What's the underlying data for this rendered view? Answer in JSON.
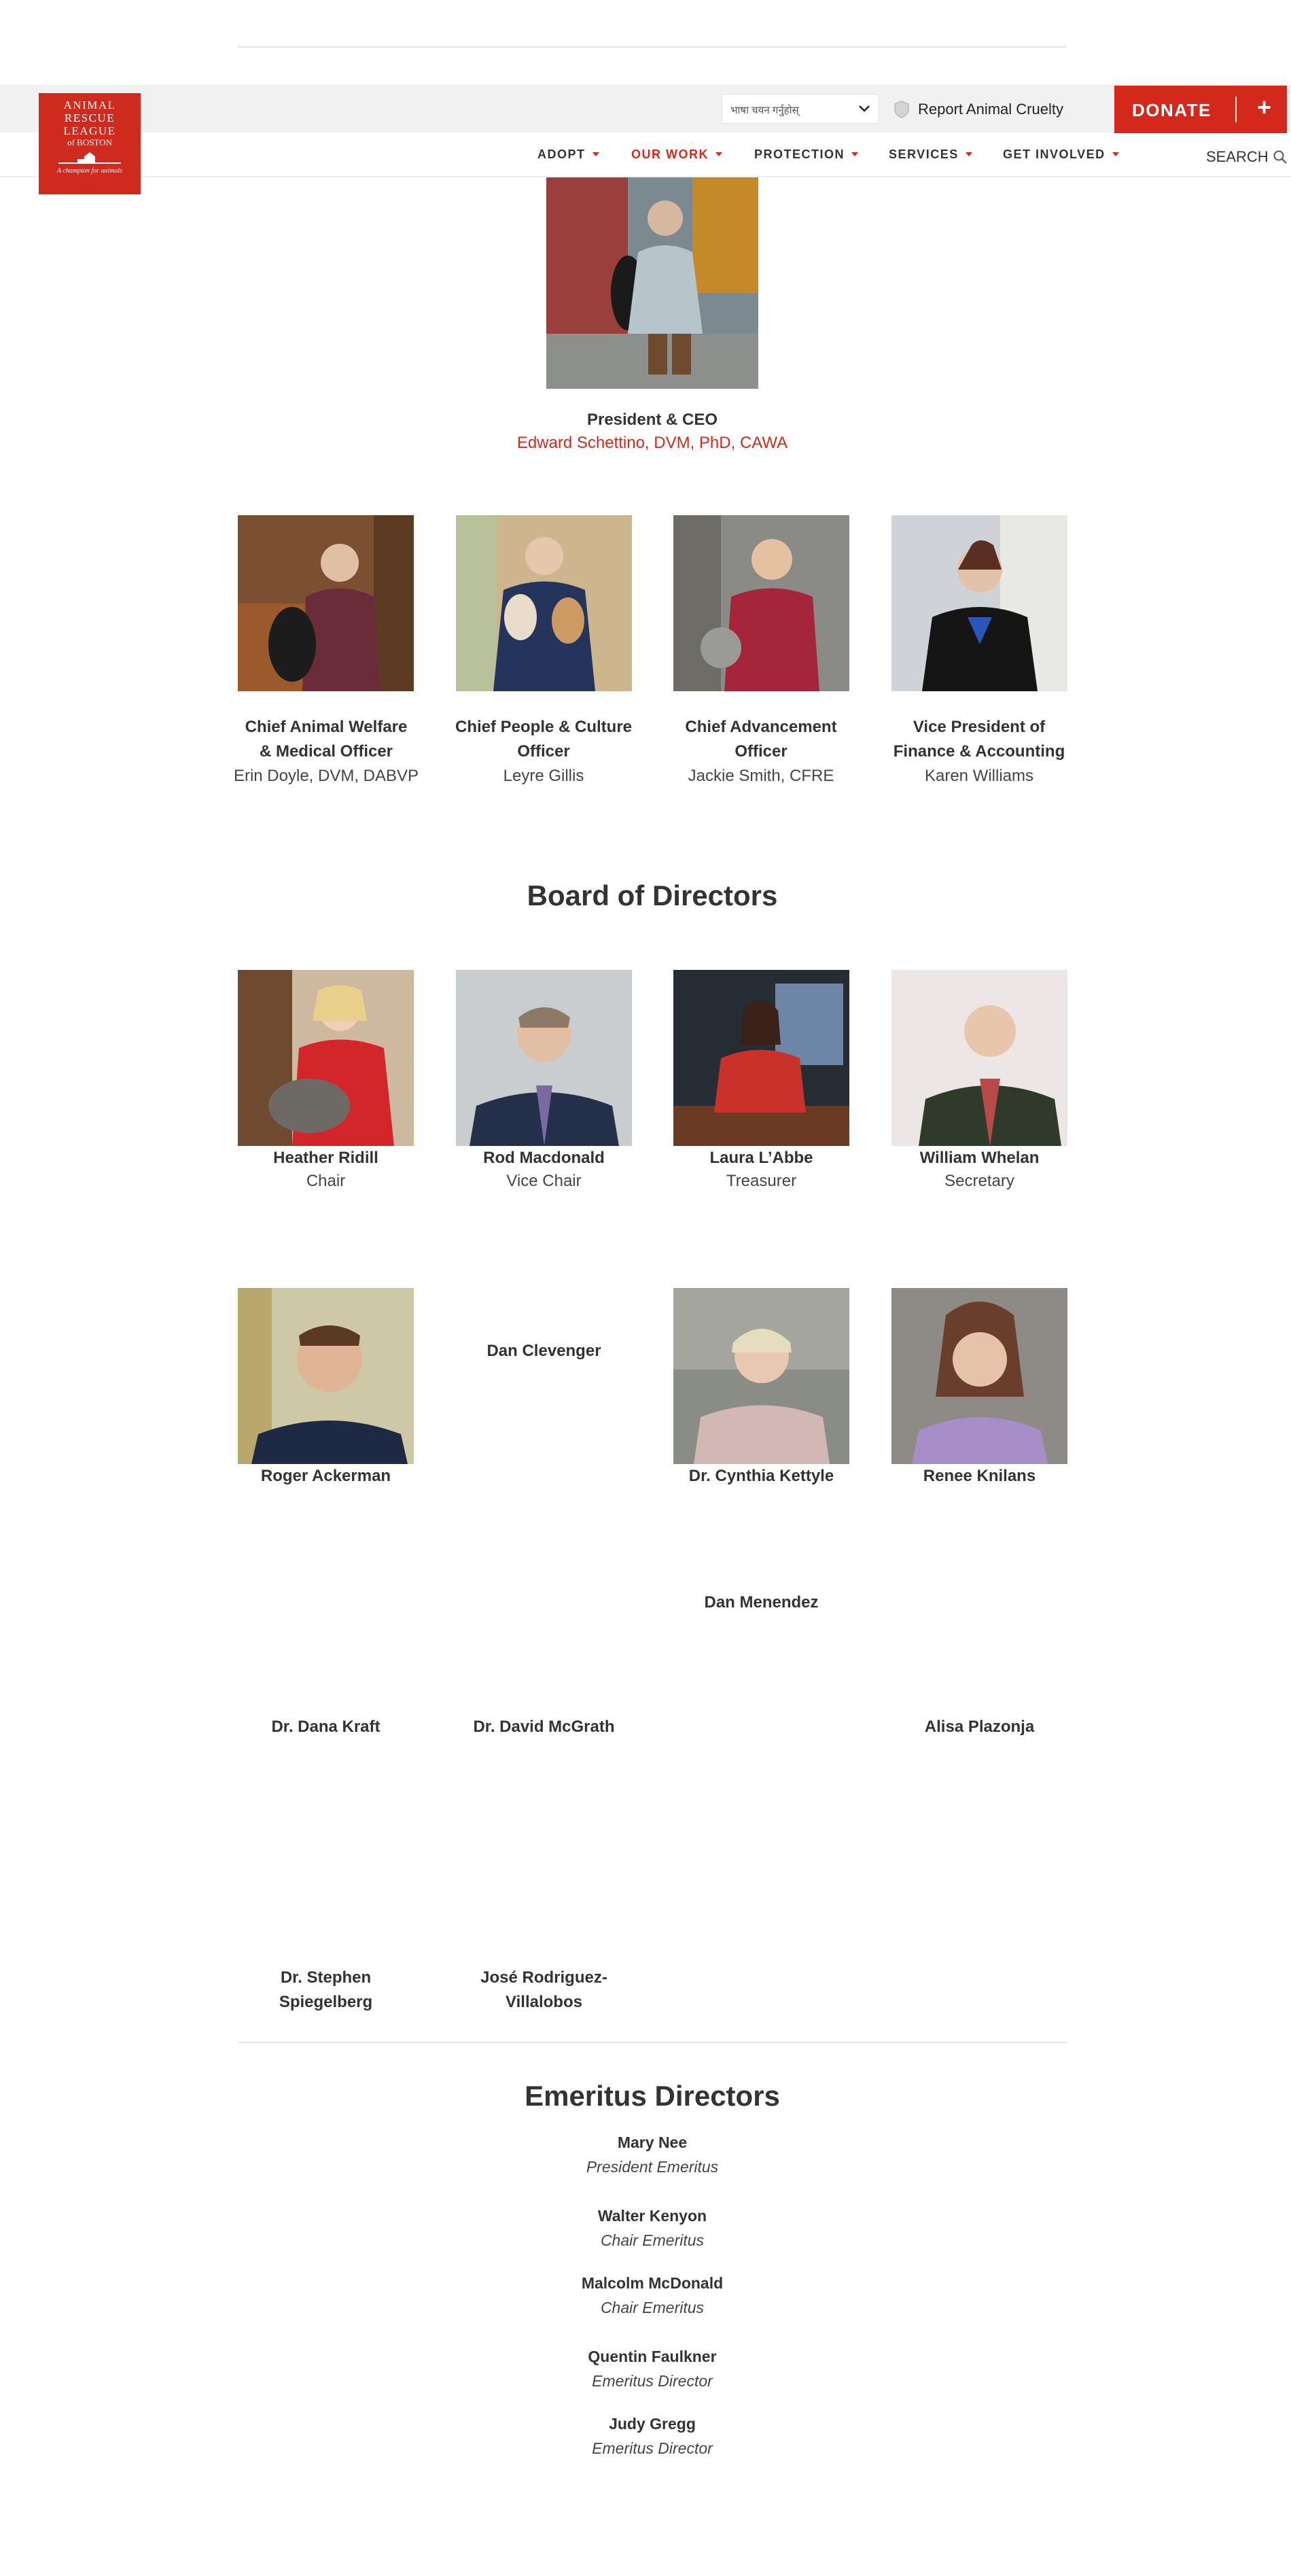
{
  "header": {
    "logo": {
      "line1": "ANIMAL",
      "line2": "RESCUE",
      "line3": "LEAGUE",
      "line4": "of BOSTON",
      "tagline": "A champion for animals"
    },
    "language_select": {
      "value": "भाषा चयन गर्नुहोस्"
    },
    "report_link": "Report Animal Cruelty",
    "donate_label": "DONATE",
    "donate_plus": "+",
    "nav": [
      {
        "label": "ADOPT"
      },
      {
        "label": "OUR WORK"
      },
      {
        "label": "PROTECTION"
      },
      {
        "label": "SERVICES"
      },
      {
        "label": "GET INVOLVED"
      }
    ],
    "search_label": "SEARCH",
    "brand_color": "#d5281c"
  },
  "ceo": {
    "title": "President & CEO",
    "name": "Edward Schettino, DVM, PhD, CAWA"
  },
  "executives": [
    {
      "title_line1": "Chief Animal Welfare",
      "title_line2": "& Medical Officer",
      "name": "Erin Doyle, DVM, DABVP"
    },
    {
      "title_line1": "Chief People & Culture",
      "title_line2": "Officer",
      "name": "Leyre Gillis"
    },
    {
      "title_line1": "Chief Advancement",
      "title_line2": "Officer",
      "name": "Jackie Smith, CFRE"
    },
    {
      "title_line1": "Vice President of",
      "title_line2": "Finance & Accounting",
      "name": "Karen Williams"
    }
  ],
  "board": {
    "heading": "Board of Directors",
    "officers": [
      {
        "name": "Heather Ridill",
        "title": "Chair"
      },
      {
        "name": "Rod Macdonald",
        "title": "Vice Chair"
      },
      {
        "name": "Laura L’Abbe",
        "title": "Treasurer"
      },
      {
        "name": "William Whelan",
        "title": "Secretary"
      }
    ],
    "members": [
      {
        "name": "Roger Ackerman"
      },
      {
        "name": "Dan Clevenger"
      },
      {
        "name": "Dr. Cynthia Kettyle"
      },
      {
        "name": "Renee Knilans"
      },
      {
        "name": "Dan Menendez"
      },
      {
        "name": "Dr. Dana Kraft"
      },
      {
        "name": "Dr. David McGrath"
      },
      {
        "name": "Alisa Plazonja"
      },
      {
        "name_line1": "Dr. Stephen",
        "name_line2": "Spiegelberg"
      },
      {
        "name_line1": "José Rodriguez-",
        "name_line2": "Villalobos"
      }
    ]
  },
  "emeritus": {
    "heading": "Emeritus Directors",
    "people": [
      {
        "name": "Mary Nee",
        "title": "President Emeritus"
      },
      {
        "name": "Walter Kenyon",
        "title": "Chair Emeritus"
      },
      {
        "name": "Malcolm McDonald",
        "title": "Chair Emeritus"
      },
      {
        "name": "Quentin Faulkner",
        "title": "Emeritus Director"
      },
      {
        "name": "Judy Gregg",
        "title": "Emeritus Director"
      }
    ]
  }
}
